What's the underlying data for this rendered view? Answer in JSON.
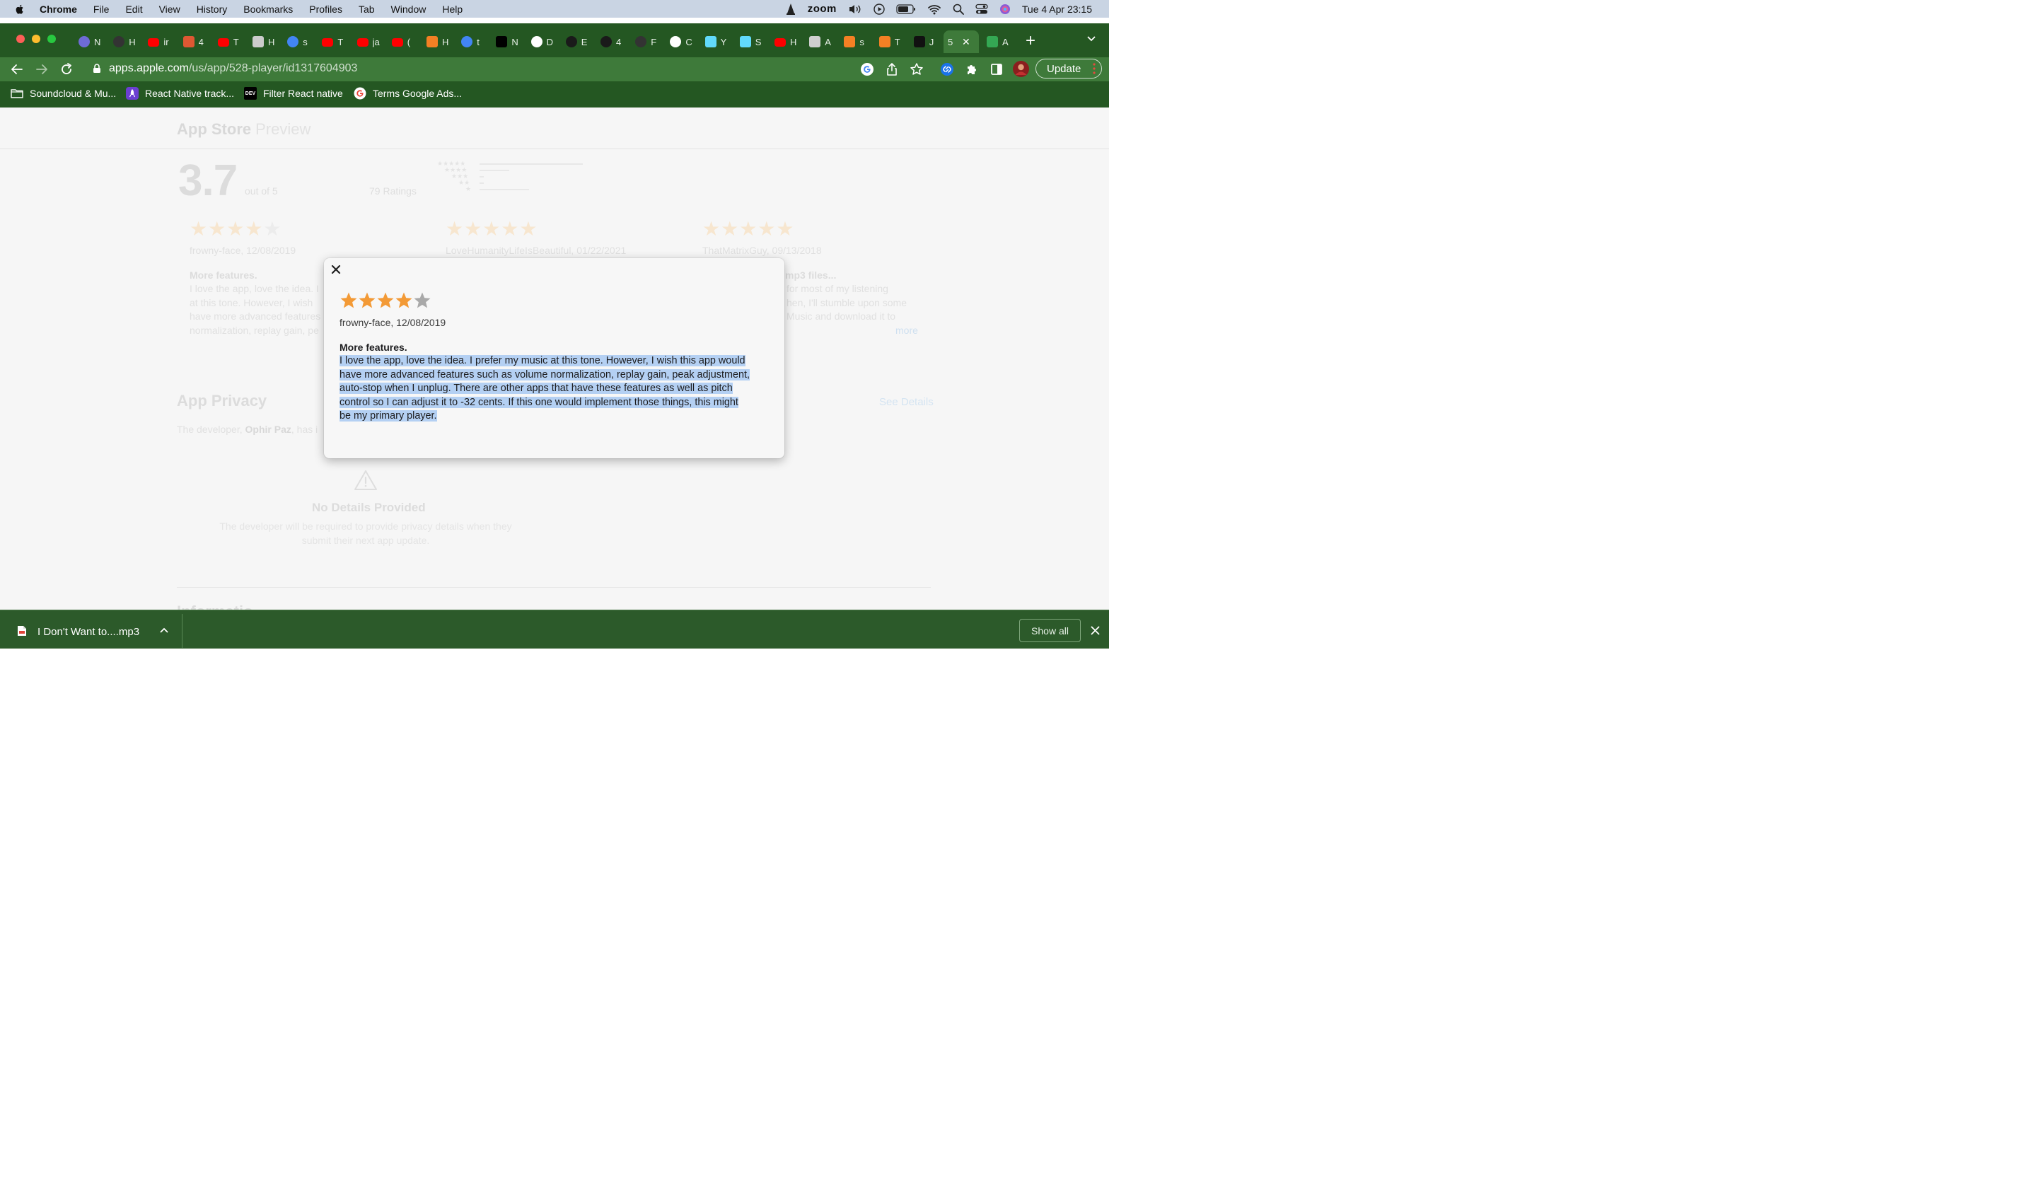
{
  "menubar": {
    "app": "Chrome",
    "items": [
      "File",
      "Edit",
      "View",
      "History",
      "Bookmarks",
      "Profiles",
      "Tab",
      "Window",
      "Help"
    ],
    "zoom": "zoom",
    "clock": "Tue 4 Apr  23:15"
  },
  "tabs": [
    {
      "label": "N",
      "icon": "circle-icon",
      "color": "#6e6bd6"
    },
    {
      "label": "H",
      "icon": "github-icon",
      "color": "#333333"
    },
    {
      "label": "ir",
      "icon": "youtube-icon",
      "color": "#ff0000"
    },
    {
      "label": "4",
      "icon": "duckduckgo-icon",
      "color": "#de5833"
    },
    {
      "label": "T",
      "icon": "youtube-icon",
      "color": "#ff0000"
    },
    {
      "label": "H",
      "icon": "cube-icon",
      "color": "#cccccc"
    },
    {
      "label": "s",
      "icon": "google-icon",
      "color": "#4285f4"
    },
    {
      "label": "T",
      "icon": "youtube-icon",
      "color": "#ff0000"
    },
    {
      "label": "ja",
      "icon": "youtube-icon",
      "color": "#ff0000"
    },
    {
      "label": "(",
      "icon": "youtube-icon",
      "color": "#ff0000"
    },
    {
      "label": "H",
      "icon": "stackoverflow-icon",
      "color": "#f48024"
    },
    {
      "label": "t",
      "icon": "google-icon",
      "color": "#4285f4"
    },
    {
      "label": "N",
      "icon": "medium-icon",
      "color": "#000000"
    },
    {
      "label": "D",
      "icon": "wordpress-icon",
      "color": "#ffffff"
    },
    {
      "label": "E",
      "icon": "spotify-icon",
      "color": "#1a1a1a"
    },
    {
      "label": "4",
      "icon": "spotify-icon",
      "color": "#1a1a1a"
    },
    {
      "label": "F",
      "icon": "github-icon",
      "color": "#333333"
    },
    {
      "label": "C",
      "icon": "wordpress-icon",
      "color": "#ffffff"
    },
    {
      "label": "Y",
      "icon": "react-icon",
      "color": "#61dafb"
    },
    {
      "label": "S",
      "icon": "react-icon",
      "color": "#61dafb"
    },
    {
      "label": "H",
      "icon": "youtube-icon",
      "color": "#ff0000"
    },
    {
      "label": "A",
      "icon": "apple-icon",
      "color": "#cfcfcf"
    },
    {
      "label": "s",
      "icon": "stackoverflow-icon",
      "color": "#f48024"
    },
    {
      "label": "T",
      "icon": "stackoverflow-icon",
      "color": "#f48024"
    },
    {
      "label": "J",
      "icon": "m-icon",
      "color": "#111111"
    },
    {
      "label": "5",
      "icon": "none",
      "color": "#ffffff",
      "active": true
    },
    {
      "label": "A",
      "icon": "play-store-icon",
      "color": "#34a853"
    }
  ],
  "toolbar": {
    "url_host": "apps.apple.com",
    "url_path": "/us/app/528-player/id1317604903",
    "update_label": "Update"
  },
  "bookmarks": [
    {
      "label": "Soundcloud & Mu...",
      "icon": "folder-icon"
    },
    {
      "label": "React Native track...",
      "icon": "rocket-icon"
    },
    {
      "label": "Filter React native",
      "icon": "dev-icon",
      "badge": "DEV"
    },
    {
      "label": "Terms Google Ads...",
      "icon": "google-icon"
    }
  ],
  "page": {
    "store_title": "App Store",
    "store_sub": "Preview",
    "rating": "3.7",
    "out_of": "out of 5",
    "ratings_count": "79 Ratings",
    "reviews": [
      {
        "stars": 4,
        "author": "frowny-face, 12/08/2019",
        "title": "More features.",
        "lines": [
          "I love the app, love the idea. I",
          "at this tone. However, I wish",
          "have more advanced features",
          "normalization, replay gain, pe"
        ]
      },
      {
        "stars": 5,
        "author": "LoveHumanityLifeIsBeautiful, 01/22/2021",
        "title": "",
        "lines": []
      },
      {
        "stars": 5,
        "author": "ThatMatrixGuy, 09/13/2018",
        "title": "mp3 files...",
        "lines": [
          "for most of my listening",
          "hen, I'll stumble upon some",
          "Music and download it to"
        ],
        "more": "more"
      }
    ],
    "privacy_title": "App Privacy",
    "see_details": "See Details",
    "privacy_prefix": "The developer,",
    "privacy_dev": "Ophir Paz",
    "privacy_suffix": ", has i",
    "no_details_title": "No Details Provided",
    "no_details_line1": "The developer will be required to provide privacy details when they",
    "no_details_line2": "submit their next app update.",
    "info_title": "Informatio"
  },
  "modal": {
    "stars": 4,
    "max_stars": 5,
    "author": "frowny-face, 12/08/2019",
    "title": "More features.",
    "body_lines": [
      "I love the app, love the idea. I prefer my music at this tone. However, I wish this app would",
      "have more advanced features such as volume normalization, replay gain, peak adjustment,",
      "auto-stop when I unplug. There are other apps that have these features as well as pitch",
      "control so I can adjust it to -32 cents. If this one would implement those things, this might",
      "be my primary player."
    ],
    "star_color": "#f39a36",
    "empty_star_color": "#a9a9a9"
  },
  "download": {
    "filename": "I Don't Want to....mp3",
    "show_all": "Show all"
  }
}
